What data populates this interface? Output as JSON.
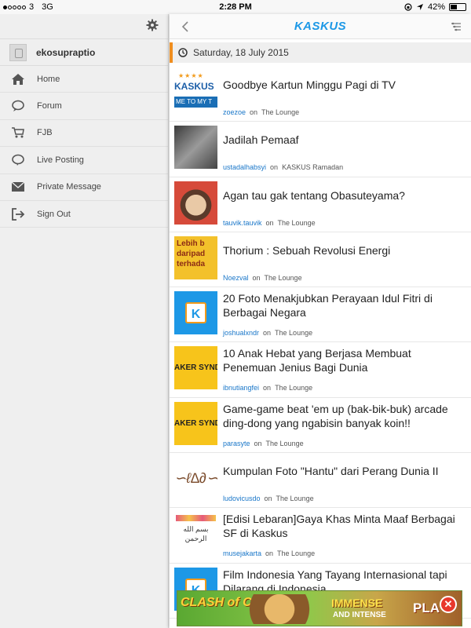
{
  "status_bar": {
    "carrier": "3",
    "network": "3G",
    "time": "2:28 PM",
    "battery": "42%",
    "battery_level": 0.42,
    "signal_bars": 1
  },
  "sidebar": {
    "username": "ekosupraptio",
    "items": [
      {
        "label": "Home",
        "icon": "home-icon"
      },
      {
        "label": "Forum",
        "icon": "speech-bubble-icon"
      },
      {
        "label": "FJB",
        "icon": "cart-icon"
      },
      {
        "label": "Live Posting",
        "icon": "speech-bubble-icon"
      },
      {
        "label": "Private Message",
        "icon": "envelope-icon"
      },
      {
        "label": "Sign Out",
        "icon": "sign-out-icon"
      }
    ]
  },
  "header": {
    "logo": "KASKUS",
    "date": "Saturday, 18 July 2015"
  },
  "connector": "on",
  "threads": [
    {
      "title": "Goodbye Kartun Minggu Pagi di TV",
      "user": "zoezoe",
      "forum": "The Lounge",
      "thumb": "kaskus-banner",
      "thumb_text": "KASKUS",
      "thumb_band": "ME TO MY T"
    },
    {
      "title": "Jadilah Pemaaf",
      "user": "ustadalhabsyi",
      "forum": "KASKUS Ramadan",
      "thumb": "hands-photo"
    },
    {
      "title": "Agan tau gak tentang Obasuteyama?",
      "user": "tauvik.tauvik",
      "forum": "The Lounge",
      "thumb": "cartoon-face"
    },
    {
      "title": "Thorium : Sebuah Revolusi Energi",
      "user": "Noezval",
      "forum": "The Lounge",
      "thumb": "yellow-text",
      "thumb_text": "Lebih b daripad terhada"
    },
    {
      "title": "20 Foto Menakjubkan Perayaan Idul Fitri di Berbagai Negara",
      "user": "joshualxndr",
      "forum": "The Lounge",
      "thumb": "kaskus-k"
    },
    {
      "title": "10 Anak Hebat yang Berjasa Membuat Penemuan Jenius Bagi Dunia",
      "user": "ibnutiangfei",
      "forum": "The Lounge",
      "thumb": "syndicate",
      "thumb_text": "AKER SYNDI"
    },
    {
      "title": "Game-game beat 'em up (bak-bik-buk) arcade ding-dong yang ngabisin banyak koin!!",
      "user": "parasyte",
      "forum": "The Lounge",
      "thumb": "syndicate",
      "thumb_text": "AKER SYNDI"
    },
    {
      "title": "Kumpulan Foto \"Hantu\" dari Perang Dunia II",
      "user": "ludovicusdo",
      "forum": "The Lounge",
      "thumb": "calligraphy"
    },
    {
      "title": "[Edisi Lebaran]Gaya Khas Minta Maaf Berbagai SF di Kaskus",
      "user": "musejakarta",
      "forum": "The Lounge",
      "thumb": "calligraphy-card"
    },
    {
      "title": "Film Indonesia Yang Tayang Internasional tapi Dilarang di Indonesia",
      "user": "",
      "forum": "",
      "thumb": "kaskus-k"
    }
  ],
  "ad": {
    "game": "CLASH of CLANS",
    "headline": "IMMENSE",
    "subline": "AND INTENSE",
    "cta": "PLA"
  },
  "colors": {
    "accent_orange": "#f08e1f",
    "kaskus_blue": "#1d98e6",
    "username_blue": "#1a77c9",
    "close_red": "#e8372c"
  }
}
